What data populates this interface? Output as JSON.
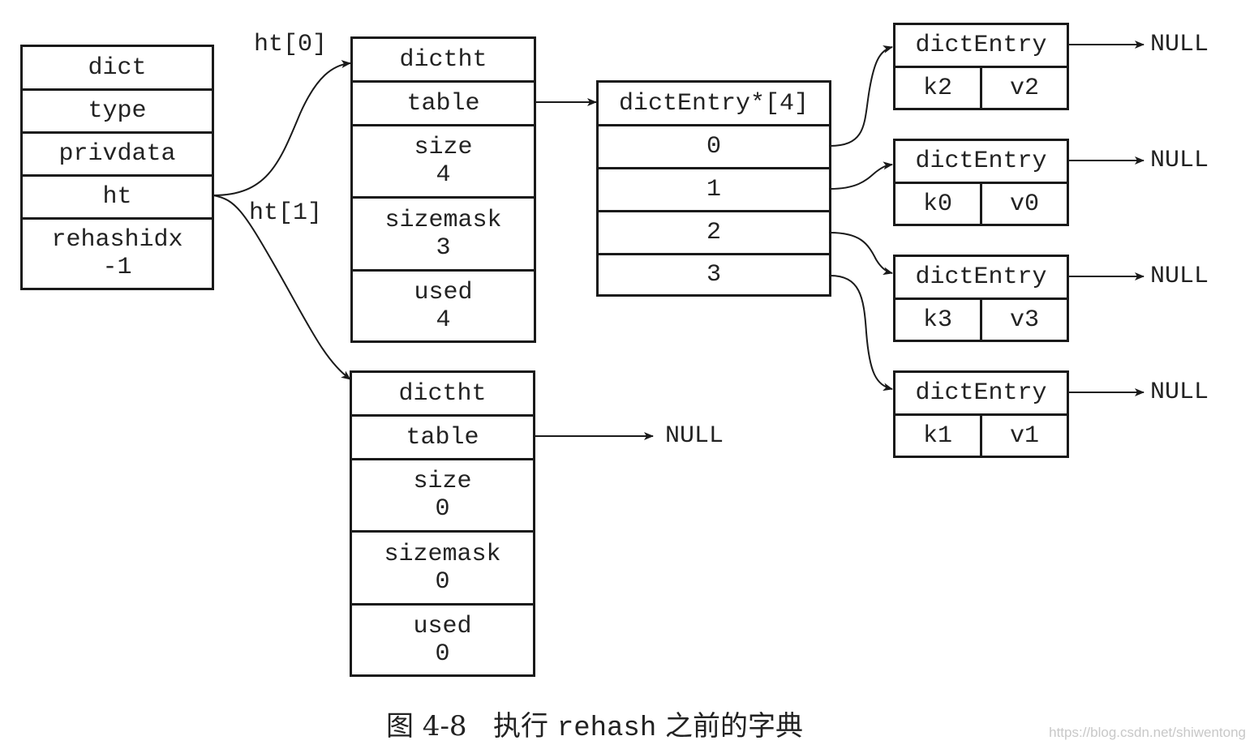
{
  "dict": {
    "fields": [
      {
        "label": "dict"
      },
      {
        "label": "type"
      },
      {
        "label": "privdata"
      },
      {
        "label": "ht"
      },
      {
        "label": "rehashidx",
        "value": "-1"
      }
    ]
  },
  "links": {
    "ht0": "ht[0]",
    "ht1": "ht[1]",
    "null": "NULL"
  },
  "ht0": {
    "fields": [
      {
        "label": "dictht"
      },
      {
        "label": "table"
      },
      {
        "label": "size",
        "value": "4"
      },
      {
        "label": "sizemask",
        "value": "3"
      },
      {
        "label": "used",
        "value": "4"
      }
    ]
  },
  "ht1": {
    "fields": [
      {
        "label": "dictht"
      },
      {
        "label": "table"
      },
      {
        "label": "size",
        "value": "0"
      },
      {
        "label": "sizemask",
        "value": "0"
      },
      {
        "label": "used",
        "value": "0"
      }
    ]
  },
  "bucket_array": {
    "title": "dictEntry*[4]",
    "indices": [
      "0",
      "1",
      "2",
      "3"
    ]
  },
  "entries": [
    {
      "title": "dictEntry",
      "key": "k2",
      "value": "v2"
    },
    {
      "title": "dictEntry",
      "key": "k0",
      "value": "v0"
    },
    {
      "title": "dictEntry",
      "key": "k3",
      "value": "v3"
    },
    {
      "title": "dictEntry",
      "key": "k1",
      "value": "v1"
    }
  ],
  "caption": {
    "prefix": "图 4-8",
    "text_before": "执行",
    "code": "rehash",
    "text_after": "之前的字典"
  },
  "watermark": "https://blog.csdn.net/shiwentong"
}
